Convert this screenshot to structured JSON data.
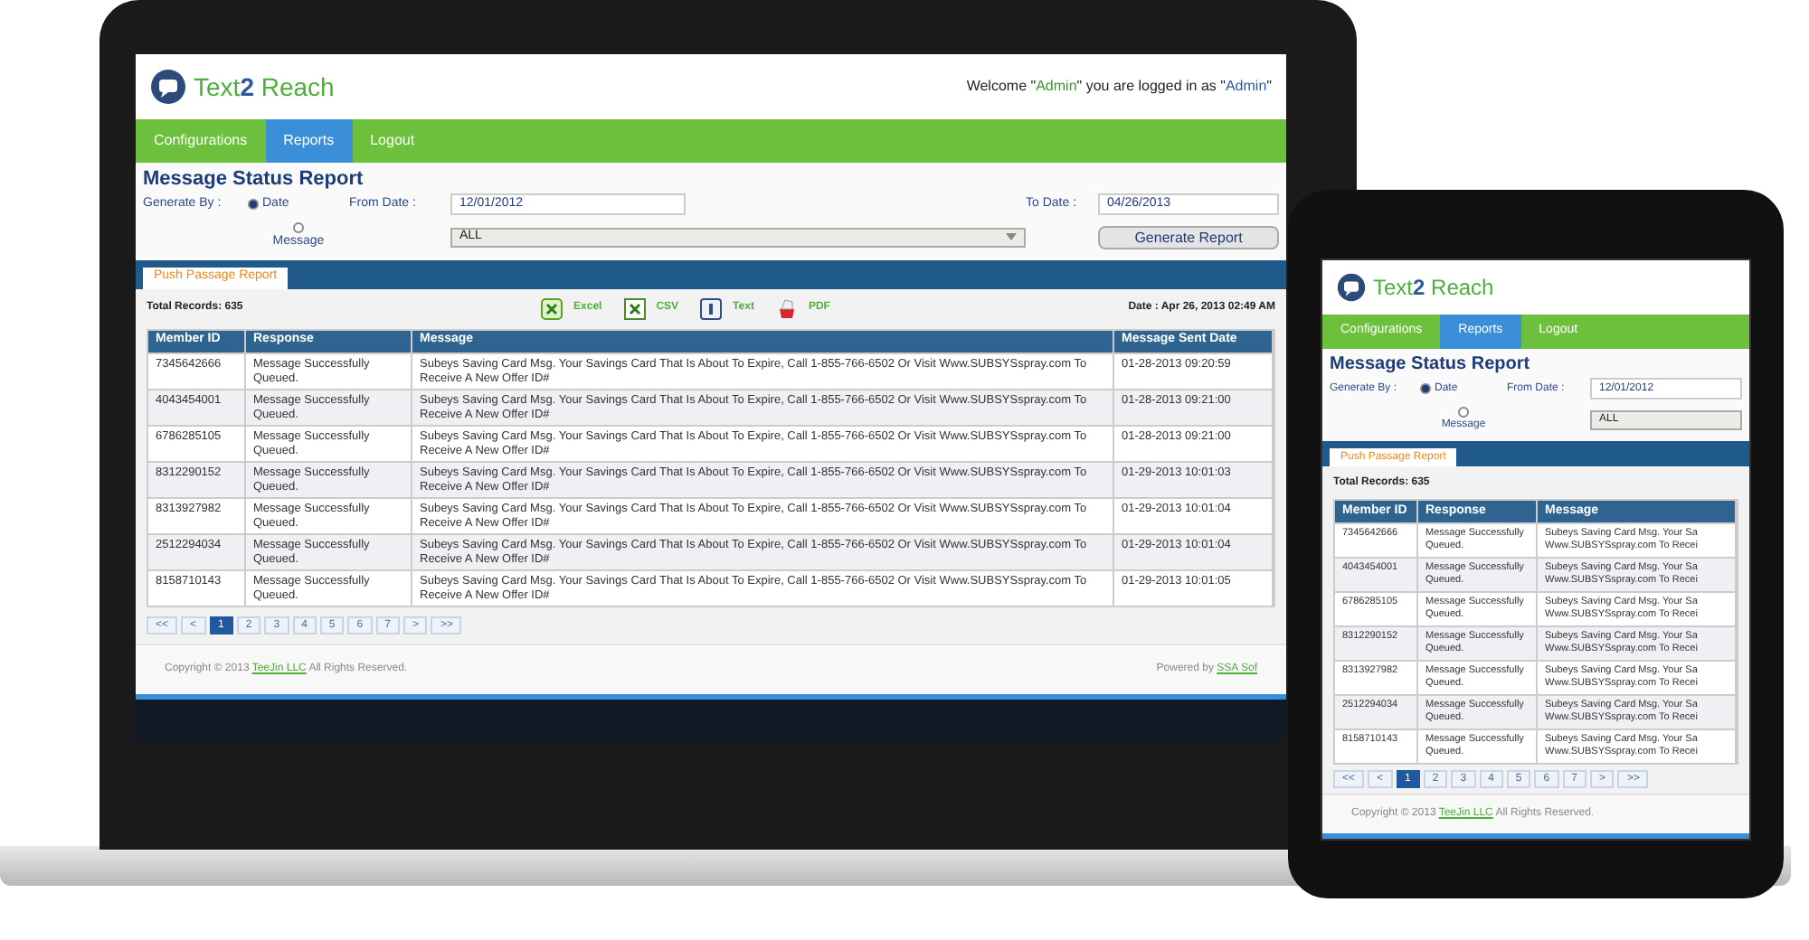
{
  "laptop": {
    "logo": {
      "text1": "Text",
      "number": "2",
      "text2": "Reach"
    },
    "welcome": {
      "prefix": "Welcome \"",
      "user": "Admin",
      "middle": "\" you are logged in as \"",
      "role": "Admin",
      "suffix": "\""
    },
    "nav": [
      {
        "label": "Configurations",
        "selected": false
      },
      {
        "label": "Reports",
        "selected": true
      },
      {
        "label": "Logout",
        "selected": false
      }
    ],
    "title": "Message Status Report",
    "generate_by_label": "Generate By :",
    "generate_by": [
      {
        "label": "Date",
        "selected": true
      },
      {
        "label": "Message",
        "selected": false
      }
    ],
    "from_date": {
      "label": "From Date :",
      "value": "12/01/2012"
    },
    "to_date": {
      "label": "To Date :",
      "value": "04/26/2013"
    },
    "message_select": {
      "value": "ALL"
    },
    "generate_button": "Generate Report",
    "tabs": [
      {
        "label": "Push Passage Report",
        "selected": true
      }
    ],
    "total_records": "Total Records: 635",
    "exports": [
      {
        "kind": "excel",
        "label": "Excel"
      },
      {
        "kind": "csv",
        "label": "CSV"
      },
      {
        "kind": "text",
        "label": "Text"
      },
      {
        "kind": "pdf",
        "label": "PDF"
      }
    ],
    "report_date": "Date : Apr 26, 2013 02:49 AM",
    "table": {
      "columns": [
        "Member ID",
        "Response",
        "Message",
        "Message Sent Date"
      ],
      "rows": [
        [
          "7345642666",
          "Message Successfully Queued.",
          "Subeys Saving Card Msg. Your Savings Card That Is About To Expire, Call 1-855-766-6502 Or Visit Www.SUBSYSspray.com To Receive A New Offer ID#",
          "01-28-2013 09:20:59"
        ],
        [
          "4043454001",
          "Message Successfully Queued.",
          "Subeys Saving Card Msg. Your Savings Card That Is About To Expire, Call 1-855-766-6502 Or Visit Www.SUBSYSspray.com To Receive A New Offer ID#",
          "01-28-2013 09:21:00"
        ],
        [
          "6786285105",
          "Message Successfully Queued.",
          "Subeys Saving Card Msg. Your Savings Card That Is About To Expire, Call 1-855-766-6502 Or Visit Www.SUBSYSspray.com To Receive A New Offer ID#",
          "01-28-2013 09:21:00"
        ],
        [
          "8312290152",
          "Message Successfully Queued.",
          "Subeys Saving Card Msg. Your Savings Card That Is About To Expire, Call 1-855-766-6502 Or Visit Www.SUBSYSspray.com To Receive A New Offer ID#",
          "01-29-2013 10:01:03"
        ],
        [
          "8313927982",
          "Message Successfully Queued.",
          "Subeys Saving Card Msg. Your Savings Card That Is About To Expire, Call 1-855-766-6502 Or Visit Www.SUBSYSspray.com To Receive A New Offer ID#",
          "01-29-2013 10:01:04"
        ],
        [
          "2512294034",
          "Message Successfully Queued.",
          "Subeys Saving Card Msg. Your Savings Card That Is About To Expire, Call 1-855-766-6502 Or Visit Www.SUBSYSspray.com To Receive A New Offer ID#",
          "01-29-2013 10:01:04"
        ],
        [
          "8158710143",
          "Message Successfully Queued.",
          "Subeys Saving Card Msg. Your Savings Card That Is About To Expire, Call 1-855-766-6502 Or Visit Www.SUBSYSspray.com To Receive A New Offer ID#",
          "01-29-2013 10:01:05"
        ]
      ]
    },
    "pagination": [
      {
        "label": "<<",
        "selected": false
      },
      {
        "label": "<",
        "selected": false
      },
      {
        "label": "1",
        "selected": true
      },
      {
        "label": "2",
        "selected": false
      },
      {
        "label": "3",
        "selected": false
      },
      {
        "label": "4",
        "selected": false
      },
      {
        "label": "5",
        "selected": false
      },
      {
        "label": "6",
        "selected": false
      },
      {
        "label": "7",
        "selected": false
      },
      {
        "label": ">",
        "selected": false
      },
      {
        "label": ">>",
        "selected": false
      }
    ],
    "footer": {
      "prefix": "Copyright © 2013",
      "company": "TeeJin LLC",
      "suffix": "All Rights Reserved.",
      "powered_by": "Powered by",
      "powered_link": "SSA Sof"
    }
  },
  "tablet": {
    "logo": {
      "text1": "Text",
      "number": "2",
      "text2": "Reach"
    },
    "nav": [
      {
        "label": "Configurations",
        "selected": false
      },
      {
        "label": "Reports",
        "selected": true
      },
      {
        "label": "Logout",
        "selected": false
      }
    ],
    "title": "Message Status Report",
    "generate_by_label": "Generate By :",
    "generate_by": [
      {
        "label": "Date",
        "selected": true
      },
      {
        "label": "Message",
        "selected": false
      }
    ],
    "from_date": {
      "label": "From Date :",
      "value": "12/01/2012"
    },
    "message_select": {
      "value": "ALL"
    },
    "tabs": [
      {
        "label": "Push Passage Report",
        "selected": true
      }
    ],
    "total_records": "Total Records: 635",
    "table": {
      "columns": [
        "Member ID",
        "Response",
        "Message"
      ],
      "rows": [
        [
          "7345642666",
          "Message Successfully Queued.",
          "Subeys Saving Card Msg. Your Sa Www.SUBSYSspray.com To Recei"
        ],
        [
          "4043454001",
          "Message Successfully Queued.",
          "Subeys Saving Card Msg. Your Sa Www.SUBSYSspray.com To Recei"
        ],
        [
          "6786285105",
          "Message Successfully Queued.",
          "Subeys Saving Card Msg. Your Sa Www.SUBSYSspray.com To Recei"
        ],
        [
          "8312290152",
          "Message Successfully Queued.",
          "Subeys Saving Card Msg. Your Sa Www.SUBSYSspray.com To Recei"
        ],
        [
          "8313927982",
          "Message Successfully Queued.",
          "Subeys Saving Card Msg. Your Sa Www.SUBSYSspray.com To Recei"
        ],
        [
          "2512294034",
          "Message Successfully Queued.",
          "Subeys Saving Card Msg. Your Sa Www.SUBSYSspray.com To Recei"
        ],
        [
          "8158710143",
          "Message Successfully Queued.",
          "Subeys Saving Card Msg. Your Sa Www.SUBSYSspray.com To Recei"
        ]
      ]
    },
    "pagination": [
      {
        "label": "<<",
        "selected": false
      },
      {
        "label": "<",
        "selected": false
      },
      {
        "label": "1",
        "selected": true
      },
      {
        "label": "2",
        "selected": false
      },
      {
        "label": "3",
        "selected": false
      },
      {
        "label": "4",
        "selected": false
      },
      {
        "label": "5",
        "selected": false
      },
      {
        "label": "6",
        "selected": false
      },
      {
        "label": "7",
        "selected": false
      },
      {
        "label": ">",
        "selected": false
      },
      {
        "label": ">>",
        "selected": false
      }
    ],
    "footer": {
      "prefix": "Copyright © 2013",
      "company": "TeeJin LLC",
      "suffix": "All Rights Reserved."
    }
  }
}
